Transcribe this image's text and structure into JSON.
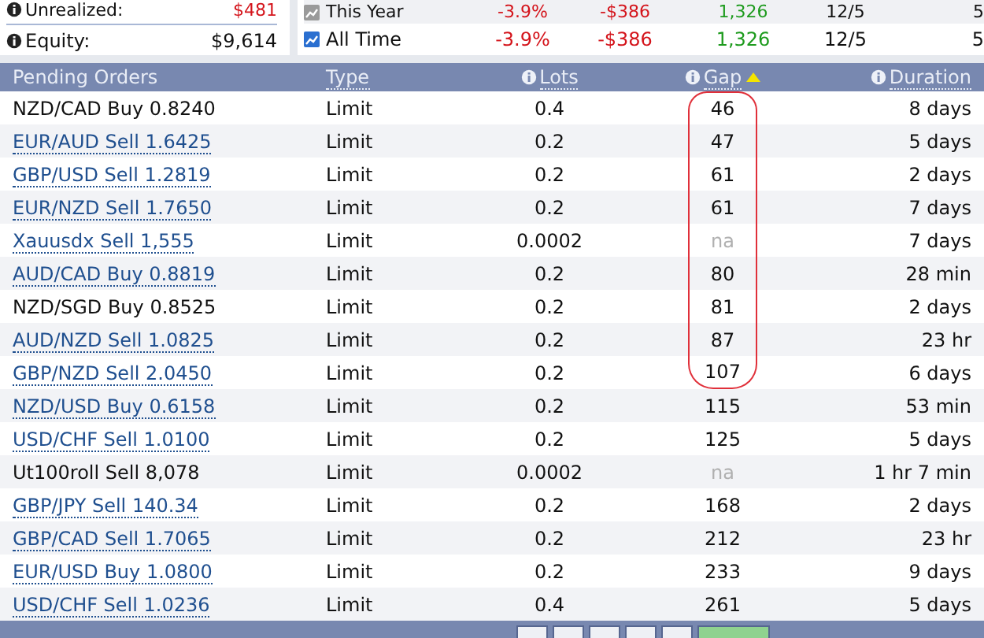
{
  "account": [
    {
      "label": "Unrealized:",
      "value": "$481",
      "color": "#d4141b"
    },
    {
      "label": "Equity:",
      "value": "$9,614",
      "color": "#111111"
    }
  ],
  "periods": [
    {
      "label": "This Year",
      "values": [
        {
          "text": "-3.9%",
          "color": "#d4141b"
        },
        {
          "text": "-$386",
          "color": "#d4141b"
        },
        {
          "text": "1,326",
          "color": "#1e9b1e"
        },
        {
          "text": "12/5",
          "color": "#111111"
        },
        {
          "text": "5",
          "color": "#111111"
        }
      ]
    },
    {
      "label": "All Time",
      "values": [
        {
          "text": "-3.9%",
          "color": "#d4141b"
        },
        {
          "text": "-$386",
          "color": "#d4141b"
        },
        {
          "text": "1,326",
          "color": "#1e9b1e"
        },
        {
          "text": "12/5",
          "color": "#111111"
        },
        {
          "text": "5",
          "color": "#111111"
        }
      ]
    }
  ],
  "table": {
    "columns": [
      {
        "label": "Pending Orders",
        "info": false,
        "sorted": false,
        "link": false
      },
      {
        "label": "Type",
        "info": false,
        "sorted": false,
        "link": true
      },
      {
        "label": "Lots",
        "info": true,
        "sorted": false,
        "link": true
      },
      {
        "label": "Gap",
        "info": true,
        "sorted": true,
        "link": true
      },
      {
        "label": "Duration",
        "info": true,
        "sorted": false,
        "link": true
      }
    ],
    "rows": [
      {
        "order": "NZD/CAD Buy 0.8240",
        "link": false,
        "type": "Limit",
        "lots": "0.4",
        "gap": "46",
        "gap_na": false,
        "circled": true,
        "duration": "8 days"
      },
      {
        "order": "EUR/AUD Sell 1.6425",
        "link": true,
        "type": "Limit",
        "lots": "0.2",
        "gap": "47",
        "gap_na": false,
        "circled": true,
        "duration": "5 days"
      },
      {
        "order": "GBP/USD Sell 1.2819",
        "link": true,
        "type": "Limit",
        "lots": "0.2",
        "gap": "61",
        "gap_na": false,
        "circled": true,
        "duration": "2 days"
      },
      {
        "order": "EUR/NZD Sell 1.7650",
        "link": true,
        "type": "Limit",
        "lots": "0.2",
        "gap": "61",
        "gap_na": false,
        "circled": true,
        "duration": "7 days"
      },
      {
        "order": "Xauusdx Sell 1,555",
        "link": true,
        "type": "Limit",
        "lots": "0.0002",
        "gap": "na",
        "gap_na": true,
        "circled": true,
        "duration": "7 days"
      },
      {
        "order": "AUD/CAD Buy 0.8819",
        "link": true,
        "type": "Limit",
        "lots": "0.2",
        "gap": "80",
        "gap_na": false,
        "circled": true,
        "duration": "28 min"
      },
      {
        "order": "NZD/SGD Buy 0.8525",
        "link": false,
        "type": "Limit",
        "lots": "0.2",
        "gap": "81",
        "gap_na": false,
        "circled": true,
        "duration": "2 days"
      },
      {
        "order": "AUD/NZD Sell 1.0825",
        "link": true,
        "type": "Limit",
        "lots": "0.2",
        "gap": "87",
        "gap_na": false,
        "circled": true,
        "duration": "23 hr"
      },
      {
        "order": "GBP/NZD Sell 2.0450",
        "link": true,
        "type": "Limit",
        "lots": "0.2",
        "gap": "107",
        "gap_na": false,
        "circled": true,
        "duration": "6 days"
      },
      {
        "order": "NZD/USD Buy 0.6158",
        "link": true,
        "type": "Limit",
        "lots": "0.2",
        "gap": "115",
        "gap_na": false,
        "circled": false,
        "duration": "53 min"
      },
      {
        "order": "USD/CHF Sell 1.0100",
        "link": true,
        "type": "Limit",
        "lots": "0.2",
        "gap": "125",
        "gap_na": false,
        "circled": false,
        "duration": "5 days"
      },
      {
        "order": "Ut100roll Sell 8,078",
        "link": false,
        "type": "Limit",
        "lots": "0.0002",
        "gap": "na",
        "gap_na": true,
        "circled": false,
        "duration": "1 hr 7 min"
      },
      {
        "order": "GBP/JPY Sell 140.34",
        "link": true,
        "type": "Limit",
        "lots": "0.2",
        "gap": "168",
        "gap_na": false,
        "circled": false,
        "duration": "2 days"
      },
      {
        "order": "GBP/CAD Sell 1.7065",
        "link": true,
        "type": "Limit",
        "lots": "0.2",
        "gap": "212",
        "gap_na": false,
        "circled": false,
        "duration": "23 hr"
      },
      {
        "order": "EUR/USD Buy 1.0800",
        "link": true,
        "type": "Limit",
        "lots": "0.2",
        "gap": "233",
        "gap_na": false,
        "circled": false,
        "duration": "9 days"
      },
      {
        "order": "USD/CHF Sell 1.0236",
        "link": true,
        "type": "Limit",
        "lots": "0.4",
        "gap": "261",
        "gap_na": false,
        "circled": false,
        "duration": "5 days"
      }
    ]
  }
}
